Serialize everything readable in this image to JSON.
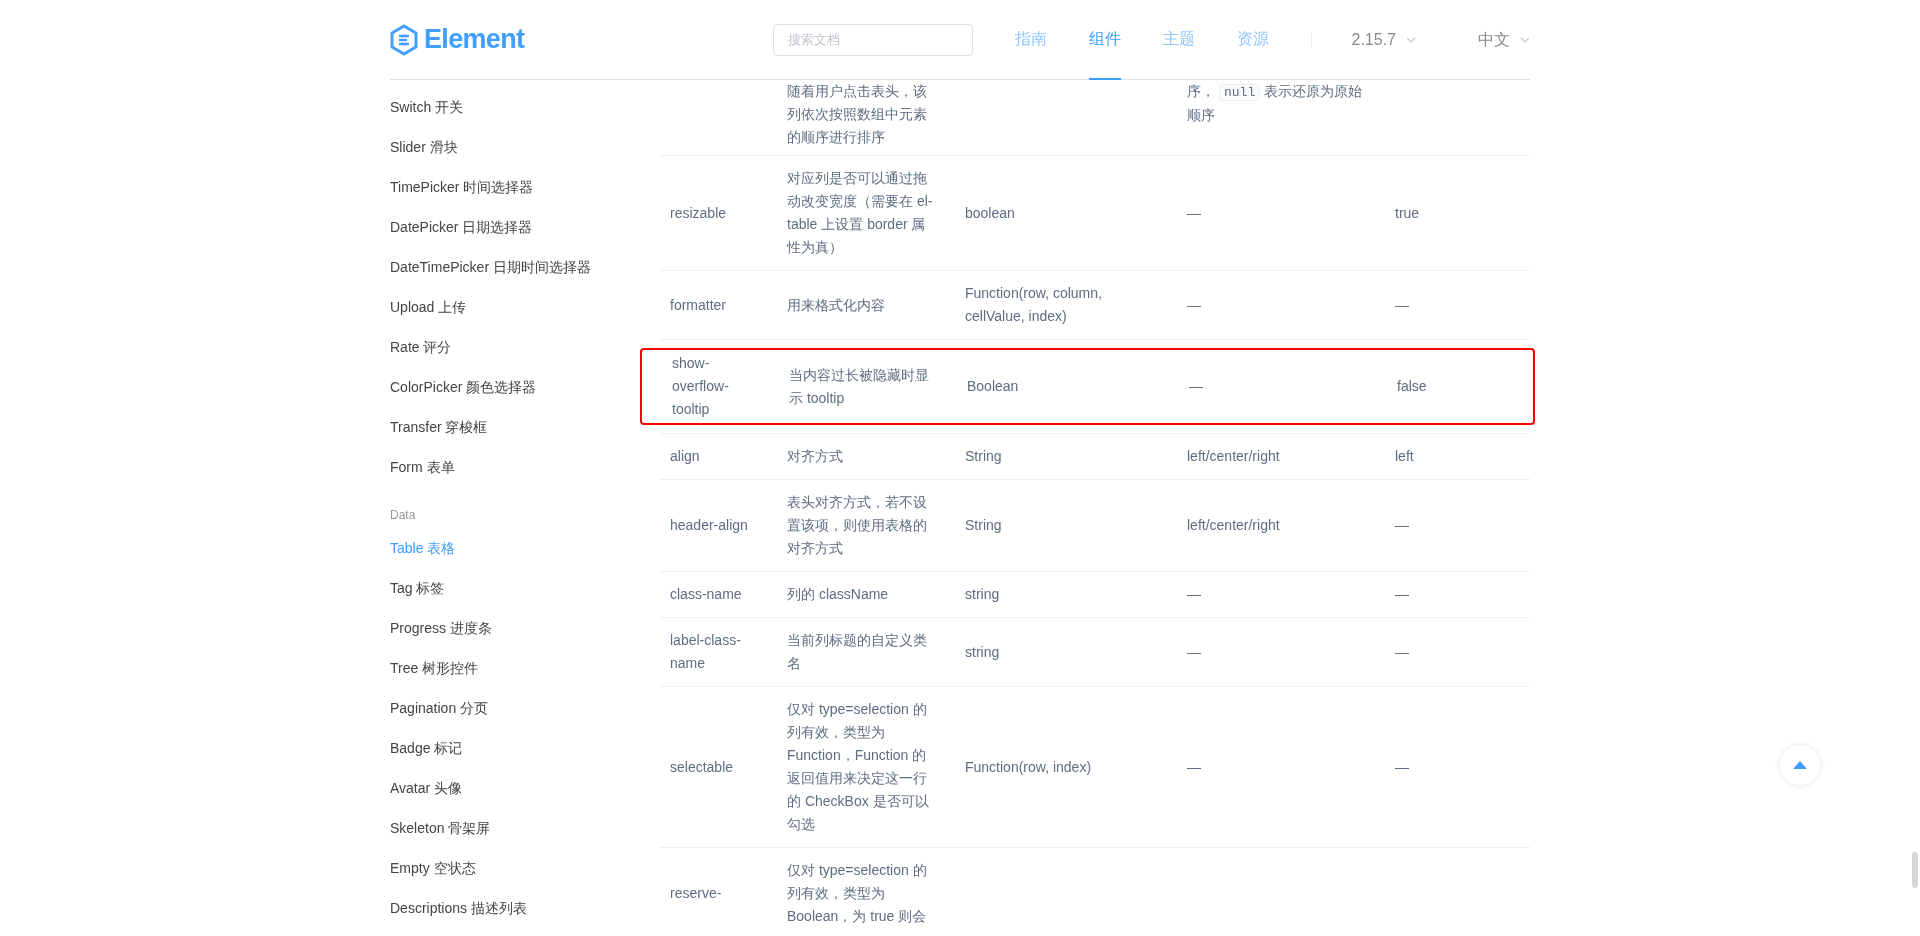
{
  "header": {
    "logo": "Element",
    "search": {
      "placeholder": "搜索文档"
    },
    "nav": [
      {
        "label": "指南",
        "selected": false
      },
      {
        "label": "组件",
        "selected": true
      },
      {
        "label": "主题",
        "selected": false
      },
      {
        "label": "资源",
        "selected": false
      }
    ],
    "version": "2.15.7",
    "language": "中文"
  },
  "sidebar": {
    "items": [
      {
        "kind": "item",
        "label": "Switch 开关",
        "selected": false
      },
      {
        "kind": "item",
        "label": "Slider 滑块",
        "selected": false
      },
      {
        "kind": "item",
        "label": "TimePicker 时间选择器",
        "selected": false
      },
      {
        "kind": "item",
        "label": "DatePicker 日期选择器",
        "selected": false
      },
      {
        "kind": "item",
        "label": "DateTimePicker 日期时间选择器",
        "selected": false
      },
      {
        "kind": "item",
        "label": "Upload 上传",
        "selected": false
      },
      {
        "kind": "item",
        "label": "Rate 评分",
        "selected": false
      },
      {
        "kind": "item",
        "label": "ColorPicker 颜色选择器",
        "selected": false
      },
      {
        "kind": "item",
        "label": "Transfer 穿梭框",
        "selected": false
      },
      {
        "kind": "item",
        "label": "Form 表单",
        "selected": false
      },
      {
        "kind": "group",
        "label": "Data"
      },
      {
        "kind": "item",
        "label": "Table 表格",
        "selected": true
      },
      {
        "kind": "item",
        "label": "Tag 标签",
        "selected": false
      },
      {
        "kind": "item",
        "label": "Progress 进度条",
        "selected": false
      },
      {
        "kind": "item",
        "label": "Tree 树形控件",
        "selected": false
      },
      {
        "kind": "item",
        "label": "Pagination 分页",
        "selected": false
      },
      {
        "kind": "item",
        "label": "Badge 标记",
        "selected": false
      },
      {
        "kind": "item",
        "label": "Avatar 头像",
        "selected": false
      },
      {
        "kind": "item",
        "label": "Skeleton 骨架屏",
        "selected": false
      },
      {
        "kind": "item",
        "label": "Empty 空状态",
        "selected": false
      },
      {
        "kind": "item",
        "label": "Descriptions 描述列表",
        "selected": false
      }
    ]
  },
  "table": {
    "rows": [
      {
        "description": "随着用户点击表头，该列依次按照数组中元素的顺序进行排序",
        "options": [
          {
            "kind": "text",
            "text": "序，"
          },
          {
            "kind": "code",
            "text": "null"
          },
          {
            "kind": "text",
            "text": "表示还原为原始顺序"
          }
        ],
        "highlighted": false
      },
      {
        "param": "resizable",
        "description": "对应列是否可以通过拖动改变宽度（需要在 el-table 上设置 border 属性为真）",
        "type": "boolean",
        "options": "—",
        "default": "true",
        "highlighted": false
      },
      {
        "param": "formatter",
        "description": "用来格式化内容",
        "type": "Function(row, column, cellValue, index)",
        "options": "—",
        "default": "—",
        "highlighted": false
      },
      {
        "param": "show-overflow-tooltip",
        "description": "当内容过长被隐藏时显示 tooltip",
        "type": "Boolean",
        "options": "—",
        "default": "false",
        "highlighted": true
      },
      {
        "param": "align",
        "description": "对齐方式",
        "type": "String",
        "options": "left/center/right",
        "default": "left",
        "highlighted": false
      },
      {
        "param": "header-align",
        "description": "表头对齐方式，若不设置该项，则使用表格的对齐方式",
        "type": "String",
        "options": "left/center/right",
        "default": "—",
        "highlighted": false
      },
      {
        "param": "class-name",
        "description": "列的 className",
        "type": "string",
        "options": "—",
        "default": "—",
        "highlighted": false
      },
      {
        "param": "label-class-name",
        "description": "当前列标题的自定义类名",
        "type": "string",
        "options": "—",
        "default": "—",
        "highlighted": false
      },
      {
        "param": "selectable",
        "description": "仅对 type=selection 的列有效，类型为 Function，Function 的返回值用来决定这一行的 CheckBox 是否可以勾选",
        "type": "Function(row, index)",
        "options": "—",
        "default": "—",
        "highlighted": false
      },
      {
        "param": "reserve-",
        "description": "仅对 type=selection 的列有效，类型为 Boolean，为 true 则会",
        "highlighted": false
      }
    ]
  }
}
